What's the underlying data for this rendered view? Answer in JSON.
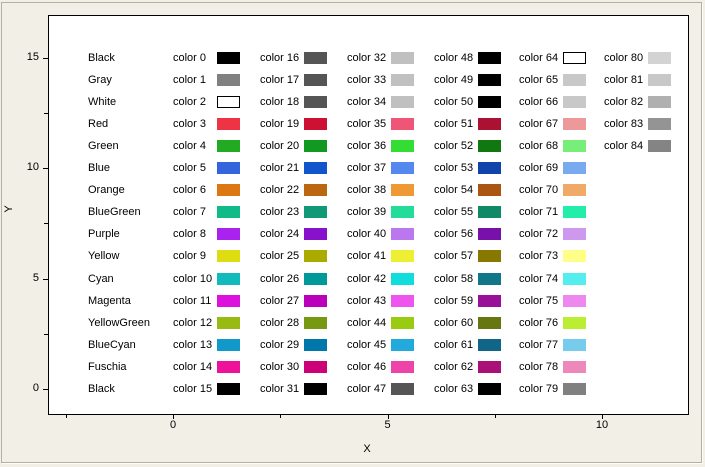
{
  "window": {
    "bg": "#f2efe6",
    "frame_border": "#b3b0a4",
    "frame_highlight": "#fdfcf6"
  },
  "chart_data": {
    "type": "table",
    "title": "",
    "xlabel": "X",
    "ylabel": "Y",
    "plot_bg": "#ffffff",
    "grid": false,
    "xlim": [
      -2.9,
      12.05
    ],
    "ylim": [
      -0.7,
      16.4
    ],
    "x_axis": {
      "major_ticks": [
        {
          "value": 0,
          "label": "0"
        },
        {
          "value": 5,
          "label": "5"
        },
        {
          "value": 10,
          "label": "10"
        }
      ],
      "minor_ticks": [
        -2.5,
        2.5,
        7.5
      ]
    },
    "y_axis": {
      "major_ticks": [
        {
          "value": 0,
          "label": "0"
        },
        {
          "value": 5,
          "label": "5"
        },
        {
          "value": 10,
          "label": "10"
        },
        {
          "value": 15,
          "label": "15"
        }
      ],
      "minor_ticks": [
        2.5,
        7.5,
        12.5
      ]
    },
    "rows": [
      "Black",
      "Gray",
      "White",
      "Red",
      "Green",
      "Blue",
      "Orange",
      "BlueGreen",
      "Purple",
      "Yellow",
      "Cyan",
      "Magenta",
      "YellowGreen",
      "BlueCyan",
      "Fuschia",
      "Black"
    ],
    "columns_x": [
      0,
      2,
      4,
      6,
      8,
      10
    ],
    "swatches": [
      {
        "label": "color 0",
        "color": "#000000"
      },
      {
        "label": "color 1",
        "color": "#808080"
      },
      {
        "label": "color 2",
        "color": "#ffffff"
      },
      {
        "label": "color 3",
        "color": "#ee3344"
      },
      {
        "label": "color 4",
        "color": "#22aa22"
      },
      {
        "label": "color 5",
        "color": "#3366dd"
      },
      {
        "label": "color 6",
        "color": "#dd7711"
      },
      {
        "label": "color 7",
        "color": "#11bb88"
      },
      {
        "label": "color 8",
        "color": "#aa22ee"
      },
      {
        "label": "color 9",
        "color": "#dddd11"
      },
      {
        "label": "color 10",
        "color": "#11bbbb"
      },
      {
        "label": "color 11",
        "color": "#dd11dd"
      },
      {
        "label": "color 12",
        "color": "#99bb11"
      },
      {
        "label": "color 13",
        "color": "#1199cc"
      },
      {
        "label": "color 14",
        "color": "#ee1199"
      },
      {
        "label": "color 15",
        "color": "#000000"
      },
      {
        "label": "color 16",
        "color": "#555555"
      },
      {
        "label": "color 17",
        "color": "#555555"
      },
      {
        "label": "color 18",
        "color": "#555555"
      },
      {
        "label": "color 19",
        "color": "#cc1133"
      },
      {
        "label": "color 20",
        "color": "#119922"
      },
      {
        "label": "color 21",
        "color": "#1155cc"
      },
      {
        "label": "color 22",
        "color": "#bb6611"
      },
      {
        "label": "color 23",
        "color": "#119977"
      },
      {
        "label": "color 24",
        "color": "#8811cc"
      },
      {
        "label": "color 25",
        "color": "#aaaa00"
      },
      {
        "label": "color 26",
        "color": "#009999"
      },
      {
        "label": "color 27",
        "color": "#bb00bb"
      },
      {
        "label": "color 28",
        "color": "#779911"
      },
      {
        "label": "color 29",
        "color": "#0077aa"
      },
      {
        "label": "color 30",
        "color": "#cc0077"
      },
      {
        "label": "color 31",
        "color": "#000000"
      },
      {
        "label": "color 32",
        "color": "#c0c0c0"
      },
      {
        "label": "color 33",
        "color": "#c0c0c0"
      },
      {
        "label": "color 34",
        "color": "#c0c0c0"
      },
      {
        "label": "color 35",
        "color": "#ee5577"
      },
      {
        "label": "color 36",
        "color": "#33dd33"
      },
      {
        "label": "color 37",
        "color": "#5588ee"
      },
      {
        "label": "color 38",
        "color": "#ee9933"
      },
      {
        "label": "color 39",
        "color": "#22dd99"
      },
      {
        "label": "color 40",
        "color": "#bb77ee"
      },
      {
        "label": "color 41",
        "color": "#eeee33"
      },
      {
        "label": "color 42",
        "color": "#11dddd"
      },
      {
        "label": "color 43",
        "color": "#ee55ee"
      },
      {
        "label": "color 44",
        "color": "#99cc11"
      },
      {
        "label": "color 45",
        "color": "#22aadd"
      },
      {
        "label": "color 46",
        "color": "#ee44aa"
      },
      {
        "label": "color 47",
        "color": "#555555"
      },
      {
        "label": "color 48",
        "color": "#000000"
      },
      {
        "label": "color 49",
        "color": "#000000"
      },
      {
        "label": "color 50",
        "color": "#000000"
      },
      {
        "label": "color 51",
        "color": "#aa1133"
      },
      {
        "label": "color 52",
        "color": "#117711"
      },
      {
        "label": "color 53",
        "color": "#1144aa"
      },
      {
        "label": "color 54",
        "color": "#aa5511"
      },
      {
        "label": "color 55",
        "color": "#118866"
      },
      {
        "label": "color 56",
        "color": "#7711aa"
      },
      {
        "label": "color 57",
        "color": "#887700"
      },
      {
        "label": "color 58",
        "color": "#117788"
      },
      {
        "label": "color 59",
        "color": "#991199"
      },
      {
        "label": "color 60",
        "color": "#667711"
      },
      {
        "label": "color 61",
        "color": "#116688"
      },
      {
        "label": "color 62",
        "color": "#aa1177"
      },
      {
        "label": "color 63",
        "color": "#000000"
      },
      {
        "label": "color 64",
        "color": "#ffffff"
      },
      {
        "label": "color 65",
        "color": "#c8c8c8"
      },
      {
        "label": "color 66",
        "color": "#c8c8c8"
      },
      {
        "label": "color 67",
        "color": "#ee9999"
      },
      {
        "label": "color 68",
        "color": "#77ee77"
      },
      {
        "label": "color 69",
        "color": "#77aaee"
      },
      {
        "label": "color 70",
        "color": "#eeaa66"
      },
      {
        "label": "color 71",
        "color": "#22eeaa"
      },
      {
        "label": "color 72",
        "color": "#cc99ee"
      },
      {
        "label": "color 73",
        "color": "#ffff88"
      },
      {
        "label": "color 74",
        "color": "#55eeee"
      },
      {
        "label": "color 75",
        "color": "#ee88ee"
      },
      {
        "label": "color 76",
        "color": "#bbee33"
      },
      {
        "label": "color 77",
        "color": "#77ccee"
      },
      {
        "label": "color 78",
        "color": "#ee88bb"
      },
      {
        "label": "color 79",
        "color": "#808080"
      },
      {
        "label": "color 80",
        "color": "#d3d3d3"
      },
      {
        "label": "color 81",
        "color": "#c8c8c8"
      },
      {
        "label": "color 82",
        "color": "#b0b0b0"
      },
      {
        "label": "color 83",
        "color": "#949494"
      },
      {
        "label": "color 84",
        "color": "#848484"
      }
    ]
  }
}
